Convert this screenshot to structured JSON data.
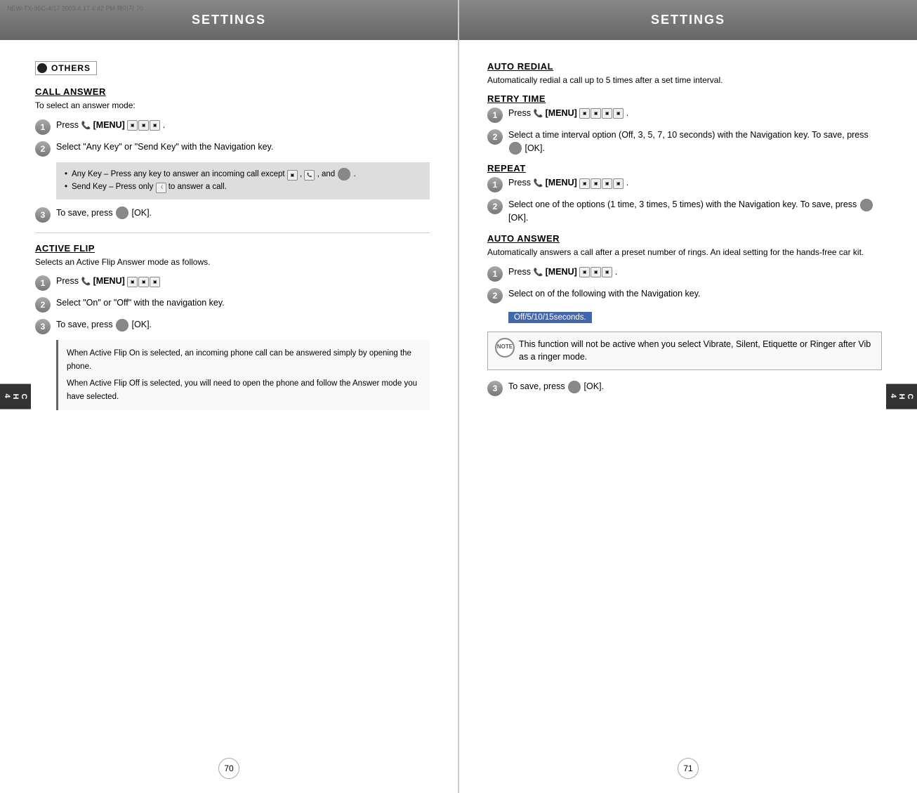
{
  "left": {
    "header": "SETTINGS",
    "file_info": "NEW-TX-95C-4/17  2003.4.17 4:42 PM  페이지 70",
    "section_tag": "OTHERS",
    "call_answer": {
      "title": "CALL ANSWER",
      "desc": "To select an answer mode:",
      "steps": [
        {
          "num": "1",
          "text": "Press  [MENU]"
        },
        {
          "num": "2",
          "text": "Select \"Any Key\" or \"Send Key\" with the Navigation key."
        },
        {
          "num": "3",
          "text": "To save, press  [OK]."
        }
      ],
      "bullets": [
        "Any Key – Press any key to answer an incoming call except      ,      , and     .",
        "Send Key – Press only      to answer a call."
      ]
    },
    "active_flip": {
      "title": "ACTIVE FLIP",
      "desc": "Selects an Active Flip Answer mode as follows.",
      "steps": [
        {
          "num": "1",
          "text": "Press  [MENU]"
        },
        {
          "num": "2",
          "text": "Select \"On\" or \"Off\" with the navigation key."
        },
        {
          "num": "3",
          "text": "To save, press  [OK]."
        }
      ],
      "info_lines": [
        "When Active Flip On is selected, an incoming phone call can be answered simply by opening the phone.",
        "When Active Flip Off is selected, you will need to open the phone and follow the Answer mode you have selected."
      ]
    },
    "page_num": "70",
    "side_tab": "CH\n4"
  },
  "right": {
    "header": "SETTINGS",
    "auto_redial": {
      "title": "AUTO REDIAL",
      "desc": "Automatically redial a call up to 5 times after a set time interval."
    },
    "retry_time": {
      "title": "RETRY TIME",
      "steps": [
        {
          "num": "1",
          "text": "Press  [MENU]"
        },
        {
          "num": "2",
          "text": "Select a time interval option (Off, 3, 5, 7, 10 seconds) with the Navigation key. To save, press  [OK]."
        }
      ]
    },
    "repeat": {
      "title": "REPEAT",
      "steps": [
        {
          "num": "1",
          "text": "Press  [MENU]"
        },
        {
          "num": "2",
          "text": "Select one of the options (1 time, 3 times, 5 times) with the Navigation key. To save, press  [OK]."
        }
      ]
    },
    "auto_answer": {
      "title": "AUTO ANSWER",
      "desc": "Automatically answers a call after a preset number of rings. An ideal setting for the hands-free car kit.",
      "steps": [
        {
          "num": "1",
          "text": "Press  [MENU]"
        },
        {
          "num": "2",
          "text": "Select on of the following with the Navigation key."
        },
        {
          "num": "3",
          "text": "To save, press  [OK]."
        }
      ],
      "highlight": "Off/5/10/15seconds.",
      "note": "This function will not be active when you select Vibrate, Silent, Etiquette or Ringer after Vib as a ringer mode."
    },
    "page_num": "71",
    "side_tab": "CH\n4"
  }
}
